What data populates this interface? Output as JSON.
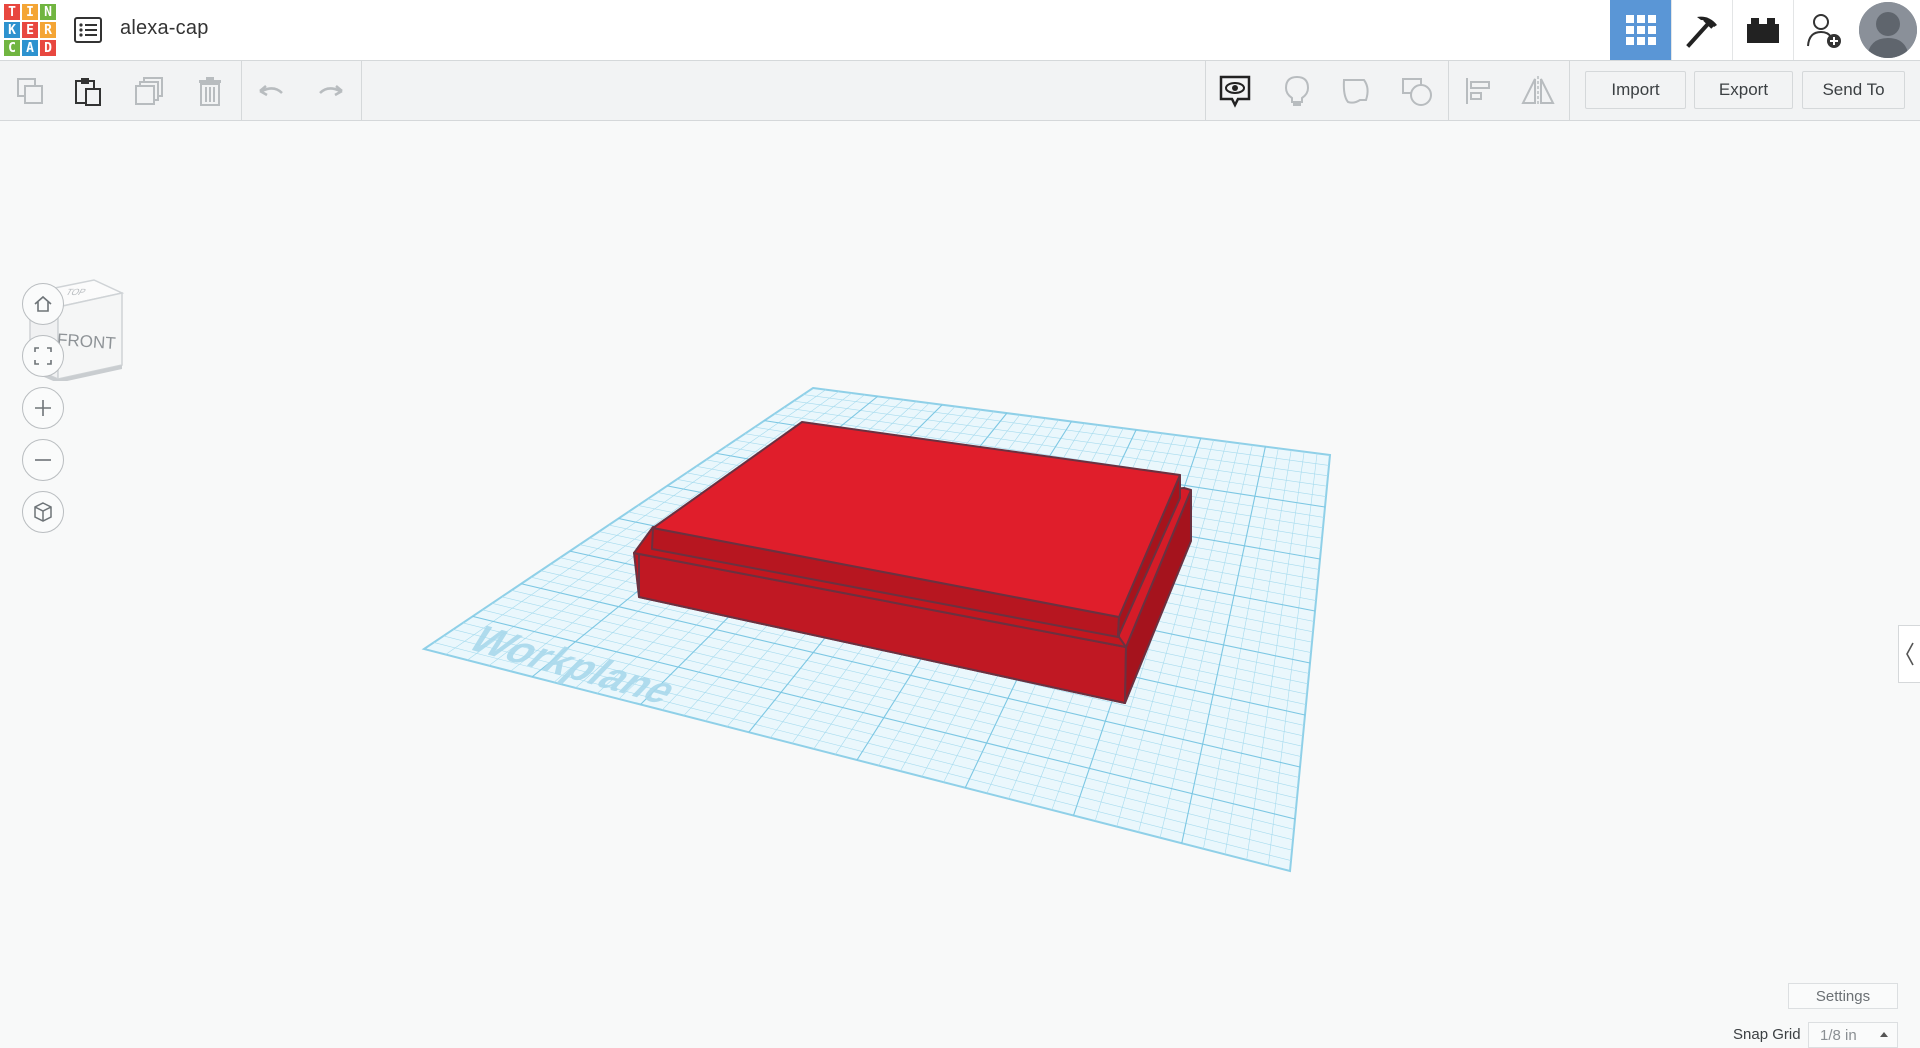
{
  "app": {
    "logo_letters": [
      "T",
      "I",
      "N",
      "K",
      "E",
      "R",
      "C",
      "A",
      "D"
    ],
    "design_title": "alexa-cap"
  },
  "topbar": {
    "icons": [
      "design-list-icon",
      "grid-view-icon",
      "pickaxe-icon",
      "bricks-icon",
      "invite-user-icon",
      "avatar-icon"
    ],
    "active_color": "#5a96d6"
  },
  "toolbar": {
    "tools": [
      "copy-icon",
      "paste-icon",
      "duplicate-icon",
      "delete-icon",
      "undo-icon",
      "redo-icon",
      "notes-icon",
      "bulb-icon",
      "shape-solid-icon",
      "shape-hole-icon",
      "align-icon",
      "mirror-icon"
    ],
    "import_label": "Import",
    "export_label": "Export",
    "send_to_label": "Send To"
  },
  "viewcube": {
    "front_label": "FRONT",
    "top_label": "TOP"
  },
  "navigation": [
    "home-icon",
    "fit-view-icon",
    "zoom-in-icon",
    "zoom-out-icon",
    "perspective-icon"
  ],
  "scene": {
    "workplane_label": "Workplane",
    "object_color": "#e01e2b",
    "grid_color": "#8fd0e8"
  },
  "bottom": {
    "settings_label": "Settings",
    "snap_grid_label": "Snap Grid",
    "snap_grid_value": "1/8 in"
  }
}
